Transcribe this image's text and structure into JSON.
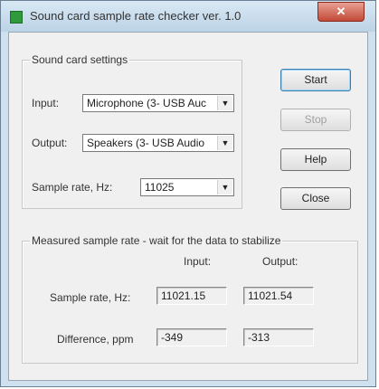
{
  "window": {
    "title": "Sound card sample rate checker ver. 1.0",
    "close_glyph": "✕"
  },
  "settings": {
    "group_label": "Sound card settings",
    "input_label": "Input:",
    "input_value": "Microphone (3- USB Auc",
    "output_label": "Output:",
    "output_value": "Speakers (3- USB Audio",
    "rate_label": "Sample rate, Hz:",
    "rate_value": "11025"
  },
  "buttons": {
    "start": "Start",
    "stop": "Stop",
    "help": "Help",
    "close": "Close"
  },
  "measured": {
    "group_label": "Measured sample rate - wait for the data to stabilize",
    "col_input": "Input:",
    "col_output": "Output:",
    "rate_label": "Sample rate, Hz:",
    "rate_input": "11021.15",
    "rate_output": "11021.54",
    "diff_label": "Difference, ppm",
    "diff_input": "-349",
    "diff_output": "-313"
  },
  "colors": {
    "title_bar": "#bcd3e6",
    "close_button": "#c24a36",
    "dialog_bg": "#f0f0f0"
  }
}
